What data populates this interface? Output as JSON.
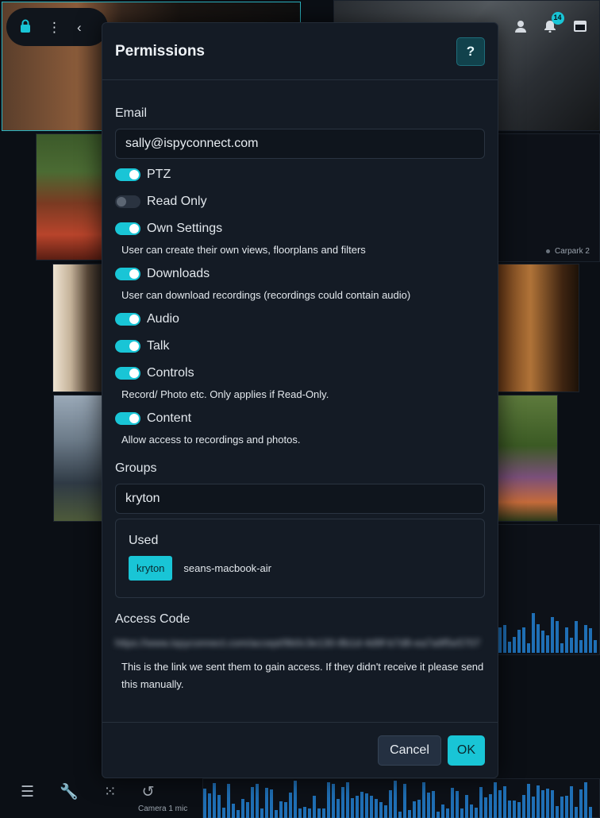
{
  "background": {
    "camera_label": "Carpark 2",
    "bottom_label": "Camera 1 mic"
  },
  "toolbar": {
    "notifications_count": "14"
  },
  "modal": {
    "title": "Permissions",
    "help_label": "?",
    "email_label": "Email",
    "email_value": "sally@ispyconnect.com",
    "permissions": [
      {
        "label": "PTZ",
        "on": true
      },
      {
        "label": "Read Only",
        "on": false
      },
      {
        "label": "Own Settings",
        "on": true,
        "help": "User can create their own views, floorplans and filters"
      },
      {
        "label": "Downloads",
        "on": true,
        "help": "User can download recordings (recordings could contain audio)"
      },
      {
        "label": "Audio",
        "on": true
      },
      {
        "label": "Talk",
        "on": true
      },
      {
        "label": "Controls",
        "on": true,
        "help": "Record/ Photo etc. Only applies if Read-Only."
      },
      {
        "label": "Content",
        "on": true,
        "help": "Allow access to recordings and photos."
      }
    ],
    "groups_label": "Groups",
    "groups_value": "kryton",
    "used_title": "Used",
    "used_tags": [
      "kryton",
      "seans-macbook-air"
    ],
    "access_code_label": "Access Code",
    "access_link": "https://www.ispyconnect.com/accept/9b0c3e130-8b1d-4d9f-b7d8-ea7a9f5e5707",
    "access_help": "This is the link we sent them to gain access. If they didn't receive it please send this manually.",
    "cancel_label": "Cancel",
    "ok_label": "OK"
  },
  "colors": {
    "accent": "#19c5d6",
    "modal_bg": "#141b25",
    "page_bg": "#0b0f15"
  }
}
